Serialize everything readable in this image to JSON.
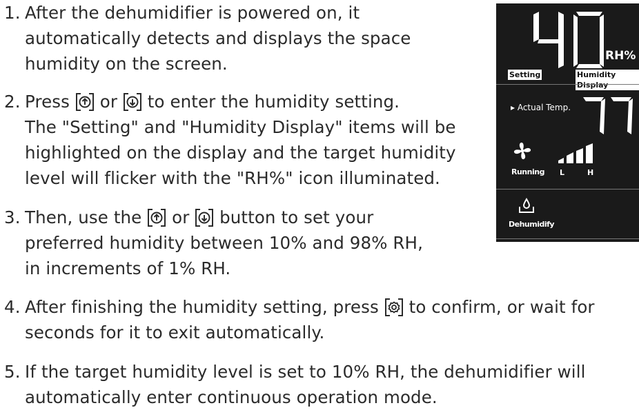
{
  "steps": [
    {
      "num": "1.",
      "lines": [
        "After the dehumidifier is powered on, it",
        "automatically detects and displays the space",
        "humidity on the screen."
      ]
    },
    {
      "num": "2.",
      "l1_a": "Press ",
      "l1_b": " or ",
      "l1_c": " to enter the humidity setting.",
      "lines": [
        "The \"Setting\" and \"Humidity Display\" items will be",
        "highlighted on the display and the target humidity",
        "level will flicker with the \"RH%\" icon illuminated."
      ]
    },
    {
      "num": "3.",
      "l1_a": "Then, use the ",
      "l1_b": " or ",
      "l1_c": " button to set your",
      "lines": [
        "preferred humidity between 10% and 98% RH,",
        "in increments of 1% RH."
      ]
    },
    {
      "num": "4.",
      "l1_a": "After finishing the humidity setting, press ",
      "l1_b": " to confirm, or wait for",
      "lines": [
        "seconds for it to exit automatically."
      ]
    },
    {
      "num": "5.",
      "l1": "If the target humidity level is set to 10% RH, the dehumidifier will",
      "lines": [
        "automatically enter continuous operation mode."
      ]
    }
  ],
  "display": {
    "humidity_value": "40",
    "rh_label": "RH%",
    "setting_tag": "Setting",
    "humidity_display_tag": "Humidity Display",
    "actual_temp_label": "▸ Actual Temp.",
    "temp_value": "77",
    "running_label": "Running",
    "fan_low": "L",
    "fan_high": "H",
    "dehumidify_label": "Dehumidify"
  },
  "colors": {
    "text": "#2b2b2b",
    "panel_bg": "#1a1a1a",
    "segment": "#ffffff"
  },
  "icons": [
    "up-arrow-icon",
    "down-arrow-icon",
    "gear-icon",
    "fan-icon",
    "water-tank-icon"
  ]
}
